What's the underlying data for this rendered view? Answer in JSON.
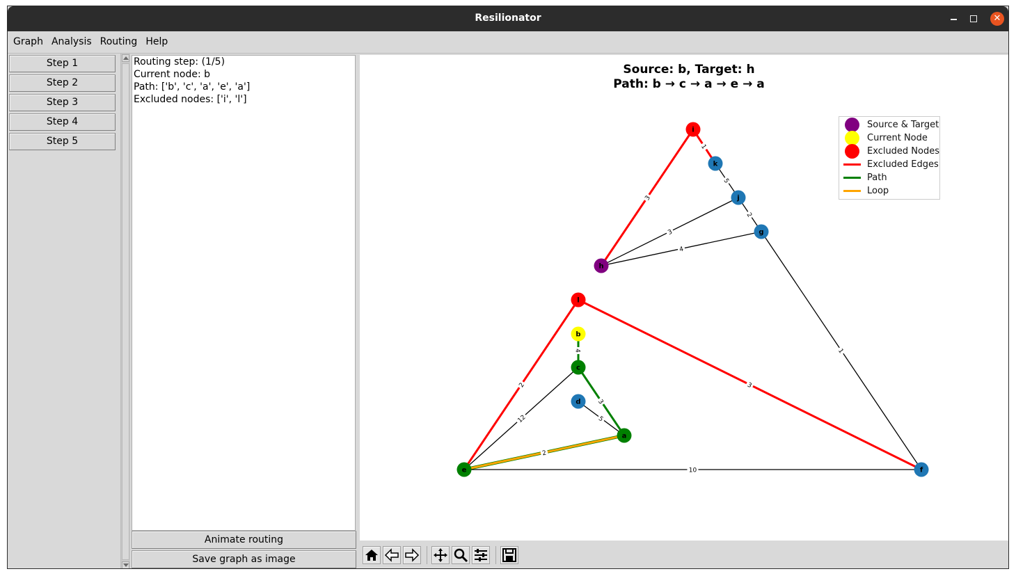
{
  "window": {
    "title": "Resilionator"
  },
  "menu": [
    "Graph",
    "Analysis",
    "Routing",
    "Help"
  ],
  "steps": [
    "Step 1",
    "Step 2",
    "Step 3",
    "Step 4",
    "Step 5"
  ],
  "info": {
    "routing_step": "Routing step: (1/5)",
    "current_node": "Current node: b",
    "path": "Path: ['b', 'c', 'a', 'e', 'a']",
    "excluded": "Excluded nodes: ['i', 'l']"
  },
  "buttons": {
    "animate": "Animate routing",
    "save": "Save graph as image"
  },
  "plot": {
    "title_line1": "Source: b, Target: h",
    "title_line2": "Path: b → c → a → e → a"
  },
  "legend": [
    {
      "label": "Source & Target",
      "kind": "dot",
      "color": "#800080"
    },
    {
      "label": "Current Node",
      "kind": "dot",
      "color": "#ffff00"
    },
    {
      "label": "Excluded Nodes",
      "kind": "dot",
      "color": "#ff0000"
    },
    {
      "label": "Excluded Edges",
      "kind": "line",
      "color": "#ff0000"
    },
    {
      "label": "Path",
      "kind": "line",
      "color": "#008000"
    },
    {
      "label": "Loop",
      "kind": "line",
      "color": "#ffa500"
    }
  ],
  "graph": {
    "nodes": [
      {
        "id": "i",
        "color": "#ff0000"
      },
      {
        "id": "k",
        "color": "#1f77b4"
      },
      {
        "id": "j",
        "color": "#1f77b4"
      },
      {
        "id": "g",
        "color": "#1f77b4"
      },
      {
        "id": "h",
        "color": "#800080"
      },
      {
        "id": "l",
        "color": "#ff0000"
      },
      {
        "id": "b",
        "color": "#ffff00"
      },
      {
        "id": "c",
        "color": "#008000"
      },
      {
        "id": "d",
        "color": "#1f77b4"
      },
      {
        "id": "a",
        "color": "#008000"
      },
      {
        "id": "e",
        "color": "#008000"
      },
      {
        "id": "f",
        "color": "#1f77b4"
      }
    ],
    "edges": [
      {
        "from": "i",
        "to": "k",
        "weight": "1",
        "style": "excluded"
      },
      {
        "from": "k",
        "to": "j",
        "weight": "5",
        "style": "normal"
      },
      {
        "from": "j",
        "to": "g",
        "weight": "2",
        "style": "normal"
      },
      {
        "from": "i",
        "to": "h",
        "weight": "3",
        "style": "excluded"
      },
      {
        "from": "j",
        "to": "h",
        "weight": "3",
        "style": "normal"
      },
      {
        "from": "g",
        "to": "h",
        "weight": "4",
        "style": "normal"
      },
      {
        "from": "g",
        "to": "f",
        "weight": "1",
        "style": "normal"
      },
      {
        "from": "l",
        "to": "e",
        "weight": "2",
        "style": "excluded"
      },
      {
        "from": "l",
        "to": "f",
        "weight": "3",
        "style": "excluded"
      },
      {
        "from": "b",
        "to": "c",
        "weight": "4",
        "style": "path"
      },
      {
        "from": "c",
        "to": "a",
        "weight": "3",
        "style": "path"
      },
      {
        "from": "c",
        "to": "e",
        "weight": "12",
        "style": "normal"
      },
      {
        "from": "d",
        "to": "a",
        "weight": "5",
        "style": "normal"
      },
      {
        "from": "e",
        "to": "a",
        "weight": "2",
        "style": "loop"
      },
      {
        "from": "e",
        "to": "f",
        "weight": "10",
        "style": "normal"
      }
    ]
  },
  "toolbar": [
    "home-icon",
    "back-icon",
    "forward-icon",
    "pan-icon",
    "zoom-icon",
    "configure-icon",
    "save-icon"
  ]
}
